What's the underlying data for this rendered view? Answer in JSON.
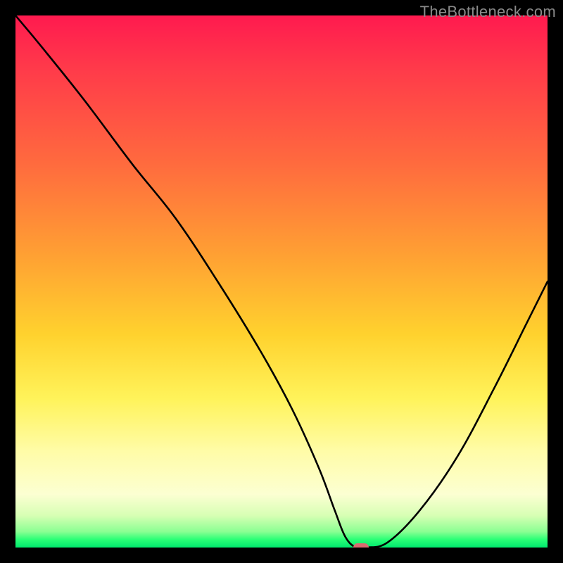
{
  "watermark": "TheBottleneck.com",
  "colors": {
    "frame": "#000000",
    "curve": "#000000",
    "marker": "#d96a6f",
    "gradient_stops": [
      "#ff1a4f",
      "#ff3a4a",
      "#ff6b3e",
      "#ffa033",
      "#ffd22e",
      "#fff35a",
      "#fffca8",
      "#fcffd2",
      "#d7ffb4",
      "#8bff93",
      "#2aff76",
      "#00e86e"
    ]
  },
  "chart_data": {
    "type": "line",
    "title": "",
    "xlabel": "",
    "ylabel": "",
    "xlim": [
      0,
      100
    ],
    "ylim": [
      0,
      100
    ],
    "series": [
      {
        "name": "bottleneck-curve",
        "x": [
          0,
          5,
          13,
          22,
          30,
          38,
          46,
          52,
          57,
          60,
          62,
          64,
          66,
          70,
          76,
          83,
          90,
          96,
          100
        ],
        "y": [
          100,
          94,
          84,
          72,
          62,
          50,
          37,
          26,
          15,
          7,
          2,
          0,
          0,
          1,
          7,
          17,
          30,
          42,
          50
        ]
      }
    ],
    "marker": {
      "x": 65,
      "y": 0
    },
    "background": {
      "description": "vertical gradient red→orange→yellow→pale→green near bottom",
      "axis": "y"
    }
  }
}
